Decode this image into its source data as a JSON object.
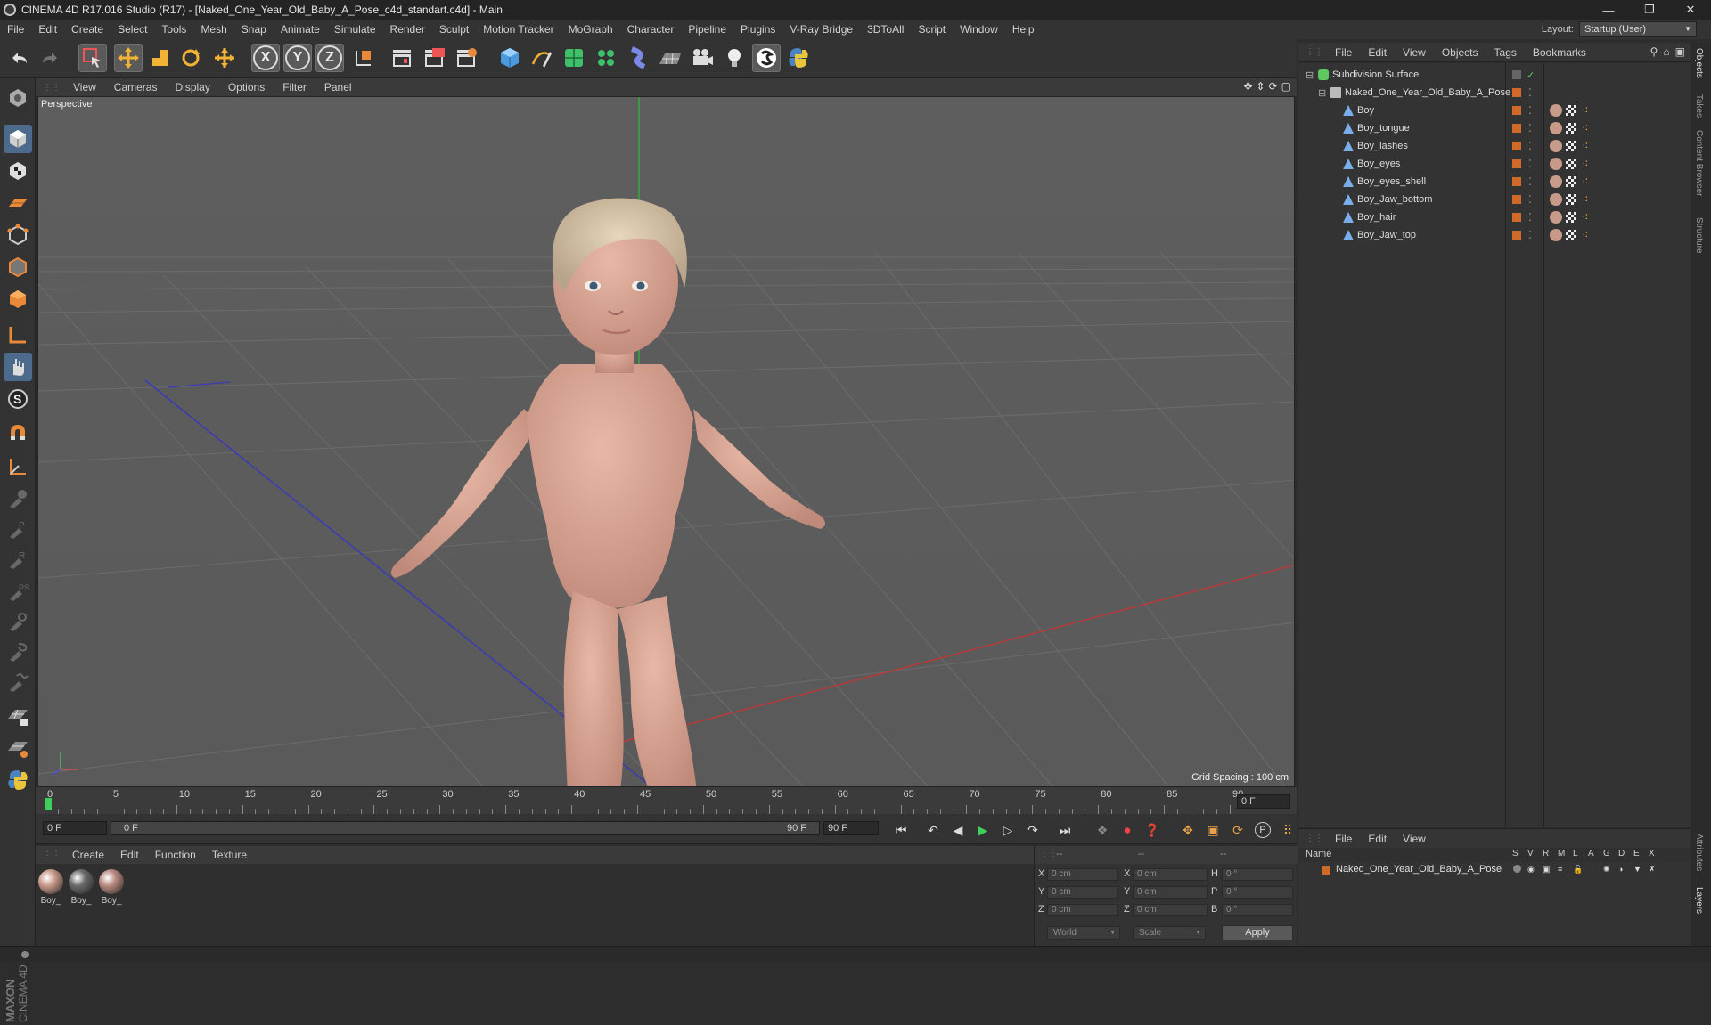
{
  "window": {
    "title": "CINEMA 4D R17.016 Studio (R17) - [Naked_One_Year_Old_Baby_A_Pose_c4d_standart.c4d] - Main"
  },
  "menubar": {
    "items": [
      "File",
      "Edit",
      "Create",
      "Select",
      "Tools",
      "Mesh",
      "Snap",
      "Animate",
      "Simulate",
      "Render",
      "Sculpt",
      "Motion Tracker",
      "MoGraph",
      "Character",
      "Pipeline",
      "Plugins",
      "V-Ray Bridge",
      "3DToAll",
      "Script",
      "Window",
      "Help"
    ],
    "layout_label": "Layout:",
    "layout_value": "Startup (User)"
  },
  "toolbar": {
    "axis_x": "X",
    "axis_y": "Y",
    "axis_z": "Z"
  },
  "viewport": {
    "menu": [
      "View",
      "Cameras",
      "Display",
      "Options",
      "Filter",
      "Panel"
    ],
    "label": "Perspective",
    "grid_spacing": "Grid Spacing : 100 cm"
  },
  "timeline": {
    "ticks": [
      "0",
      "5",
      "10",
      "15",
      "20",
      "25",
      "30",
      "35",
      "40",
      "45",
      "50",
      "55",
      "60",
      "65",
      "70",
      "75",
      "80",
      "85",
      "90"
    ],
    "current_frame_field": "0 F",
    "start_field": "0 F",
    "range_start": "0 F",
    "range_end": "90 F",
    "end_field": "90 F"
  },
  "material_manager": {
    "menu": [
      "Create",
      "Edit",
      "Function",
      "Texture"
    ],
    "materials": [
      {
        "label": "Boy_",
        "color": "#c89a8a"
      },
      {
        "label": "Boy_",
        "color": "#6a6a6a"
      },
      {
        "label": "Boy_",
        "color": "#b88a80"
      }
    ]
  },
  "coordinates": {
    "header_dashes": [
      "--",
      "--",
      "--"
    ],
    "rows": [
      {
        "a": "X",
        "a_val": "0 cm",
        "b": "X",
        "b_val": "0 cm",
        "c": "H",
        "c_val": "0 °"
      },
      {
        "a": "Y",
        "a_val": "0 cm",
        "b": "Y",
        "b_val": "0 cm",
        "c": "P",
        "c_val": "0 °"
      },
      {
        "a": "Z",
        "a_val": "0 cm",
        "b": "Z",
        "b_val": "0 cm",
        "c": "B",
        "c_val": "0 °"
      }
    ],
    "world": "World",
    "scale": "Scale",
    "apply": "Apply"
  },
  "object_manager": {
    "menu": [
      "File",
      "Edit",
      "View",
      "Objects",
      "Tags",
      "Bookmarks"
    ],
    "objects": [
      {
        "name": "Subdivision Surface",
        "level": 0,
        "icon_color": "#5fc860"
      },
      {
        "name": "Naked_One_Year_Old_Baby_A_Pose",
        "level": 1,
        "icon_color": "#bbbbbb"
      },
      {
        "name": "Boy",
        "level": 2,
        "icon_color": "#7aaeea"
      },
      {
        "name": "Boy_tongue",
        "level": 2,
        "icon_color": "#7aaeea"
      },
      {
        "name": "Boy_lashes",
        "level": 2,
        "icon_color": "#7aaeea"
      },
      {
        "name": "Boy_eyes",
        "level": 2,
        "icon_color": "#7aaeea"
      },
      {
        "name": "Boy_eyes_shell",
        "level": 2,
        "icon_color": "#7aaeea"
      },
      {
        "name": "Boy_Jaw_bottom",
        "level": 2,
        "icon_color": "#7aaeea"
      },
      {
        "name": "Boy_hair",
        "level": 2,
        "icon_color": "#7aaeea"
      },
      {
        "name": "Boy_Jaw_top",
        "level": 2,
        "icon_color": "#7aaeea"
      }
    ]
  },
  "layer_manager": {
    "menu": [
      "File",
      "Edit",
      "View"
    ],
    "columns": [
      "Name",
      "S",
      "V",
      "R",
      "M",
      "L",
      "A",
      "G",
      "D",
      "E",
      "X"
    ],
    "layers": [
      {
        "name": "Naked_One_Year_Old_Baby_A_Pose",
        "color": "#d06a2a"
      }
    ]
  },
  "side_tabs": [
    "Objects",
    "Takes",
    "Content Browser",
    "Structure",
    "Attributes",
    "Layers"
  ],
  "logo": {
    "text1": "MAXON",
    "text2": "CINEMA 4D"
  },
  "colors": {
    "accent_orange": "#e8a14a",
    "active_blue": "#4c6a8c",
    "axis_x_red": "#b83a3a",
    "axis_y_green": "#3aa83a",
    "axis_z_blue": "#3a3ab8"
  }
}
